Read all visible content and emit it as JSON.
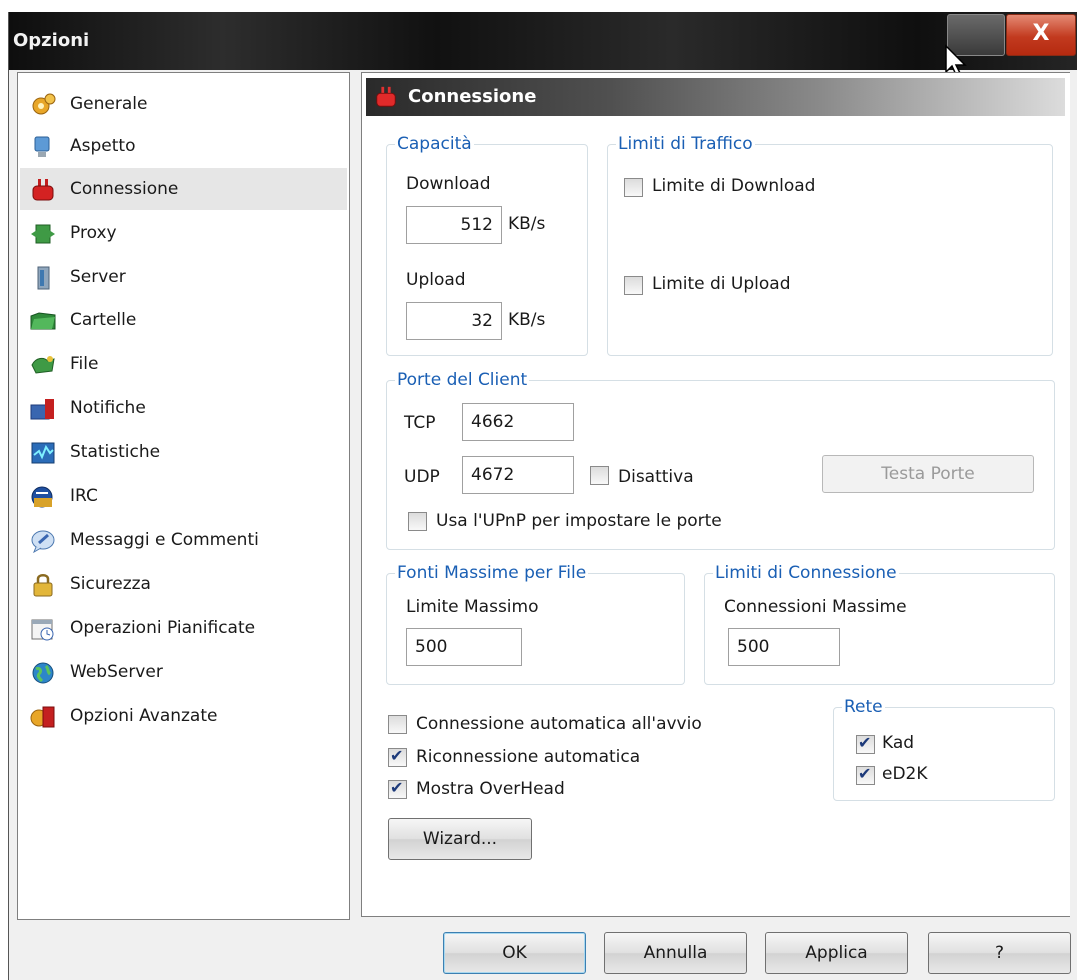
{
  "window": {
    "title": "Opzioni",
    "close_glyph": "X"
  },
  "sidebar": {
    "items": [
      {
        "label": "Generale",
        "icon": "gears-icon"
      },
      {
        "label": "Aspetto",
        "icon": "monitor-icon"
      },
      {
        "label": "Connessione",
        "icon": "plug-icon",
        "selected": true
      },
      {
        "label": "Proxy",
        "icon": "proxy-icon"
      },
      {
        "label": "Server",
        "icon": "server-icon"
      },
      {
        "label": "Cartelle",
        "icon": "folder-icon"
      },
      {
        "label": "File",
        "icon": "file-icon"
      },
      {
        "label": "Notifiche",
        "icon": "notification-icon"
      },
      {
        "label": "Statistiche",
        "icon": "statistics-icon"
      },
      {
        "label": "IRC",
        "icon": "irc-icon"
      },
      {
        "label": "Messaggi e Commenti",
        "icon": "messages-icon"
      },
      {
        "label": "Sicurezza",
        "icon": "lock-icon"
      },
      {
        "label": "Operazioni Pianificate",
        "icon": "calendar-icon"
      },
      {
        "label": "WebServer",
        "icon": "globe-icon"
      },
      {
        "label": "Opzioni Avanzate",
        "icon": "advanced-icon"
      }
    ]
  },
  "panel": {
    "header": "Connessione",
    "capacity": {
      "legend": "Capacità",
      "download_label": "Download",
      "download_value": "512",
      "upload_label": "Upload",
      "upload_value": "32",
      "unit": "KB/s"
    },
    "traffic": {
      "legend": "Limiti di Traffico",
      "download_limit_label": "Limite di Download",
      "download_limit_checked": false,
      "upload_limit_label": "Limite di Upload",
      "upload_limit_checked": false
    },
    "ports": {
      "legend": "Porte del Client",
      "tcp_label": "TCP",
      "tcp_value": "4662",
      "udp_label": "UDP",
      "udp_value": "4672",
      "disable_label": "Disattiva",
      "disable_checked": false,
      "test_button": "Testa Porte",
      "upnp_label": "Usa l'UPnP per impostare le porte",
      "upnp_checked": false
    },
    "sources": {
      "legend": "Fonti Massime per File",
      "label": "Limite Massimo",
      "value": "500"
    },
    "connections": {
      "legend": "Limiti di Connessione",
      "label": "Connessioni Massime",
      "value": "500"
    },
    "options": [
      {
        "label": "Connessione automatica all'avvio",
        "checked": false
      },
      {
        "label": "Riconnessione automatica",
        "checked": true
      },
      {
        "label": "Mostra OverHead",
        "checked": true
      }
    ],
    "network": {
      "legend": "Rete",
      "kad_label": "Kad",
      "kad_checked": true,
      "ed2k_label": "eD2K",
      "ed2k_checked": true
    },
    "wizard_button": "Wizard..."
  },
  "buttons": {
    "ok": "OK",
    "cancel": "Annulla",
    "apply": "Applica",
    "help": "?"
  }
}
